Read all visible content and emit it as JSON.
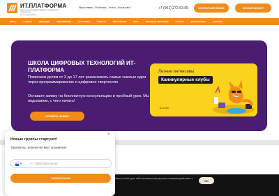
{
  "header": {
    "logo_name": "ИТ.ПЛАТФОРМА",
    "logo_sub": "Школа программирования и цифрового творчества",
    "logo_sub2": "by Алгоритмика",
    "cities": [
      "Ярославль",
      "Рыбинск",
      "Углич",
      "Кострома"
    ],
    "phone": "+7 (901) 272-53-65",
    "btn_1": "Бесплатный звонок",
    "btn_2": "Личный кабинет"
  },
  "nav": {
    "items": [
      "Курсы",
      "О школе",
      "Площадки",
      "Мероприятия",
      "Интенсивы",
      "Новости",
      "Регистрация",
      "Фото",
      "Школьная программа",
      "Отзывы",
      "Для взрослых",
      "Контакты"
    ]
  },
  "hero": {
    "title": "Школа цифровых технологий ИТ-Платформа",
    "text1": "Помогаем детям от 3 до 17 лет реализовать самые смелые идеи через программирование и цифровое творчество",
    "text2": "Оставьте заявку на бесплатную консультацию и пробный урок. Мы подскажем, с чего начать!",
    "cta": "Оставить заявку"
  },
  "promo": {
    "line1": "Летние интенсивы",
    "tag": "Каникулярные клубы",
    "age": "6-14 лет"
  },
  "cookie": {
    "text": "Мы используем файлы cookie для обеспечения наилучшего взаимодействия с сайтом",
    "ok": "OK"
  },
  "popup": {
    "close": "×",
    "title": "Новые группы стартуют!",
    "subtitle": "Торопитесь, количество мест ограничено",
    "phone_placeholder": "+7 (000) 000-00-00",
    "submit": "Записаться"
  },
  "colors": {
    "accent": "#f28c18",
    "hero_bg": "#4b1d72",
    "promo_bg": "#fbd31c"
  }
}
